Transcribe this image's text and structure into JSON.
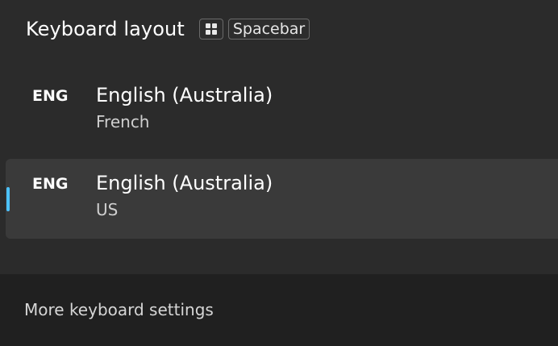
{
  "header": {
    "title": "Keyboard layout",
    "shortcut_win_icon": "windows-logo-icon",
    "shortcut_key": "Spacebar"
  },
  "layouts": [
    {
      "code": "ENG",
      "language": "English (Australia)",
      "keyboard": "French",
      "selected": false
    },
    {
      "code": "ENG",
      "language": "English (Australia)",
      "keyboard": "US",
      "selected": true
    }
  ],
  "footer": {
    "link": "More keyboard settings"
  },
  "colors": {
    "accent": "#4cc2ff",
    "panel": "#2b2b2b",
    "selected_bg": "#3a3a3a",
    "footer_bg": "#202020"
  }
}
